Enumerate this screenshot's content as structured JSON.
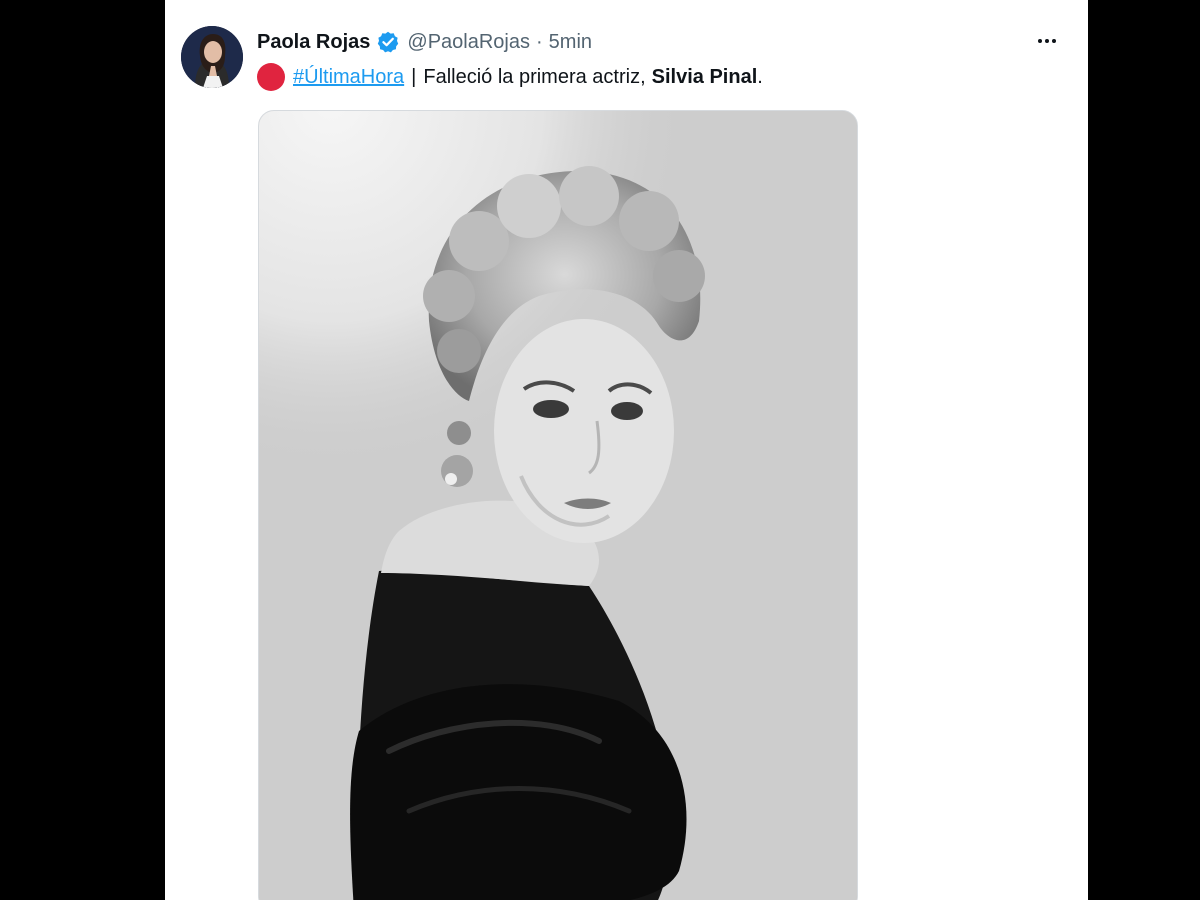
{
  "tweet": {
    "author_name": "Paola Rojas",
    "handle": "@PaolaRojas",
    "separator": "·",
    "time": "5min",
    "hashtag": "#ÚltimaHora",
    "divider": "|",
    "text_before": "Falleció la primera actriz,",
    "text_bold": "Silvia Pinal",
    "text_after": "."
  },
  "icons": {
    "verified": "verified-badge-icon",
    "more": "more-options-icon",
    "breaking": "red-circle-icon"
  },
  "colors": {
    "accent": "#1d9bf0",
    "breaking_red": "#e0243f",
    "text": "#0f1419",
    "muted": "#536471"
  }
}
